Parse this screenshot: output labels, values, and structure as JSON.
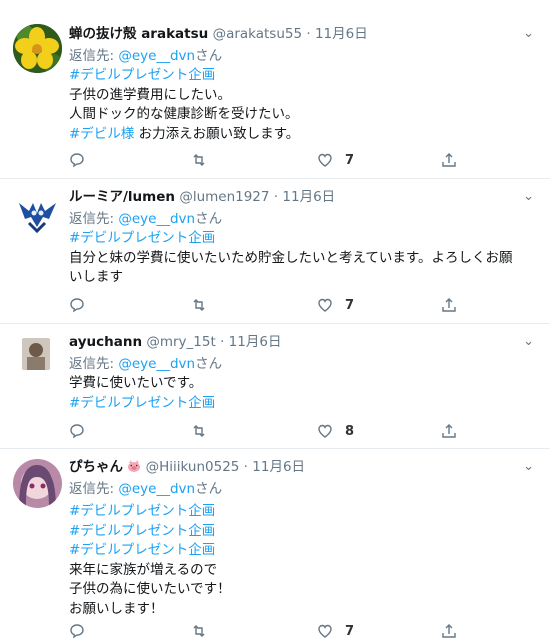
{
  "reply_prefix": "返信先:",
  "reply_to": "@eye__dvn",
  "reply_suffix": "さん",
  "tweets": [
    {
      "name": "蝉の抜け殻 arakatsu",
      "handle": "@arakatsu55",
      "dot": "·",
      "time": "11月6日",
      "lines": [
        "#デビルプレゼント企画",
        "子供の進学費用にしたい。",
        "人間ドック的な健康診断を受けたい。"
      ],
      "last_hash": "#デビル様",
      "last_rest": " お力添えお願い致します。",
      "likes": "7"
    },
    {
      "name": "ルーミア/lumen",
      "handle": "@lumen1927",
      "dot": "·",
      "time": "11月6日",
      "lines": [
        "#デビルプレゼント企画",
        "自分と妹の学費に使いたいため貯金したいと考えています。よろしくお願",
        "いします"
      ],
      "likes": "7"
    },
    {
      "name": "ayuchann",
      "handle": "@mry_15t",
      "dot": "·",
      "time": "11月6日",
      "lines": [
        "学費に使いたいです。",
        "#デビルプレゼント企画"
      ],
      "likes": "8"
    },
    {
      "name": "ぴちゃん",
      "handle": "@Hiiikun0525",
      "dot": "·",
      "time": "11月6日",
      "lines": [
        "#デビルプレゼント企画",
        "#デビルプレゼント企画",
        "#デビルプレゼント企画",
        "来年に家族が増えるので",
        "子供の為に使いたいです！",
        "お願いします！"
      ],
      "likes": "7"
    }
  ]
}
